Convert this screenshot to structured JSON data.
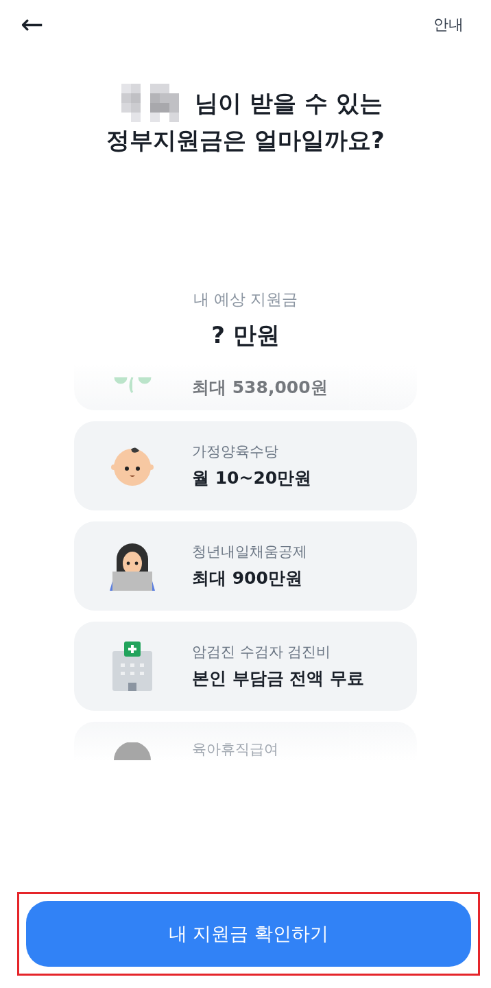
{
  "header": {
    "back_label": "←",
    "info_link": "안내"
  },
  "title": {
    "line1_suffix": "님이 받을 수 있는",
    "line2": "정부지원금은 얼마일까요?"
  },
  "estimate": {
    "label": "내 예상 지원금",
    "amount": "? 만원"
  },
  "benefits": [
    {
      "kind": "faded_bottom",
      "amount": "최대 538,000원"
    },
    {
      "kind": "card",
      "name": "가정양육수당",
      "amount": "월 10~20만원"
    },
    {
      "kind": "card",
      "name": "청년내일채움공제",
      "amount": "최대 900만원"
    },
    {
      "kind": "card",
      "name": "암검진 수검자 검진비",
      "amount": "본인 부담금 전액 무료"
    },
    {
      "kind": "faded_top",
      "name": "육아휴직급여"
    }
  ],
  "cta": {
    "label": "내 지원금 확인하기",
    "highlighted": true
  }
}
